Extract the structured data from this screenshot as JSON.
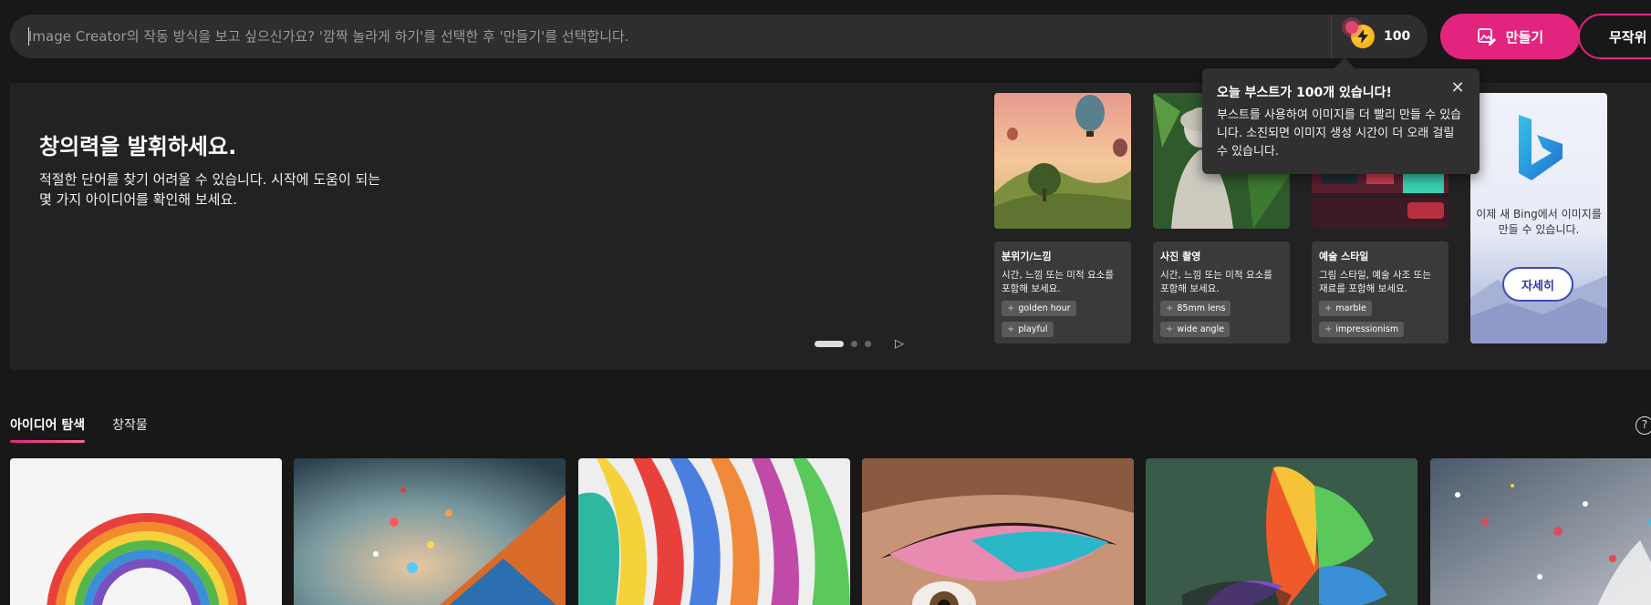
{
  "search": {
    "placeholder": "Image Creator의 작동 방식을 보고 싶으신가요? '깜짝 놀라게 하기'를 선택한 후 '만들기'를 선택합니다."
  },
  "boost": {
    "count": "100",
    "icon": "lightning-coin-icon"
  },
  "actions": {
    "create_label": "만들기",
    "free_label": "무작위"
  },
  "hero": {
    "title": "창의력을 발휘하세요.",
    "description": "적절한 단어를 찾기 어려울 수 있습니다. 시작에 도움이 되는 몇 가지 아이디어를 확인해 보세요."
  },
  "cards": [
    {
      "title": "분위기/느낌",
      "desc": "시간, 느낌 또는 미적 요소를 포함해 보세요.",
      "chips": [
        "golden hour",
        "playful"
      ]
    },
    {
      "title": "사진 촬영",
      "desc": "시간, 느낌 또는 미적 요소를 포함해 보세요.",
      "chips": [
        "85mm lens",
        "wide angle"
      ]
    },
    {
      "title": "예술 스타일",
      "desc": "그림 스타일, 예술 사조 또는 재료를 포함해 보세요.",
      "chips": [
        "marble",
        "impressionism"
      ]
    }
  ],
  "bing_card": {
    "text": "이제 새 Bing에서 이미지를 만들 수 있습니다.",
    "button": "자세히"
  },
  "tooltip": {
    "title": "오늘 부스트가 100개 있습니다!",
    "body": "부스트를 사용하여 이미지를 더 빨리 만들 수 있습니다. 소진되면 이미지 생성 시간이 더 오래 걸릴 수 있습니다."
  },
  "tabs": [
    {
      "label": "아이디어 탐색",
      "active": true
    },
    {
      "label": "창작물",
      "active": false
    }
  ],
  "colors": {
    "accent": "#e3247f",
    "background": "#181818",
    "panel": "#222222"
  }
}
